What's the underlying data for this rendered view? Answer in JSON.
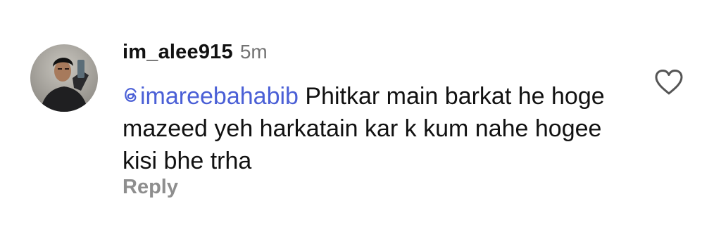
{
  "comment": {
    "username": "im_alee915",
    "timestamp": "5m",
    "mention": "imareebahabib",
    "text": " Phitkar main barkat he hoge mazeed yeh harkatain kar k kum nahe hogee kisi bhe trha",
    "reply_label": "Reply",
    "avatar_icon": "user-avatar-photo",
    "like_icon": "heart-outline-icon",
    "mention_icon": "threads-at-icon"
  },
  "colors": {
    "username": "#111111",
    "timestamp": "#737373",
    "mention": "#4a5fd6",
    "reply": "#8e8e8e",
    "icon": "#555555"
  }
}
